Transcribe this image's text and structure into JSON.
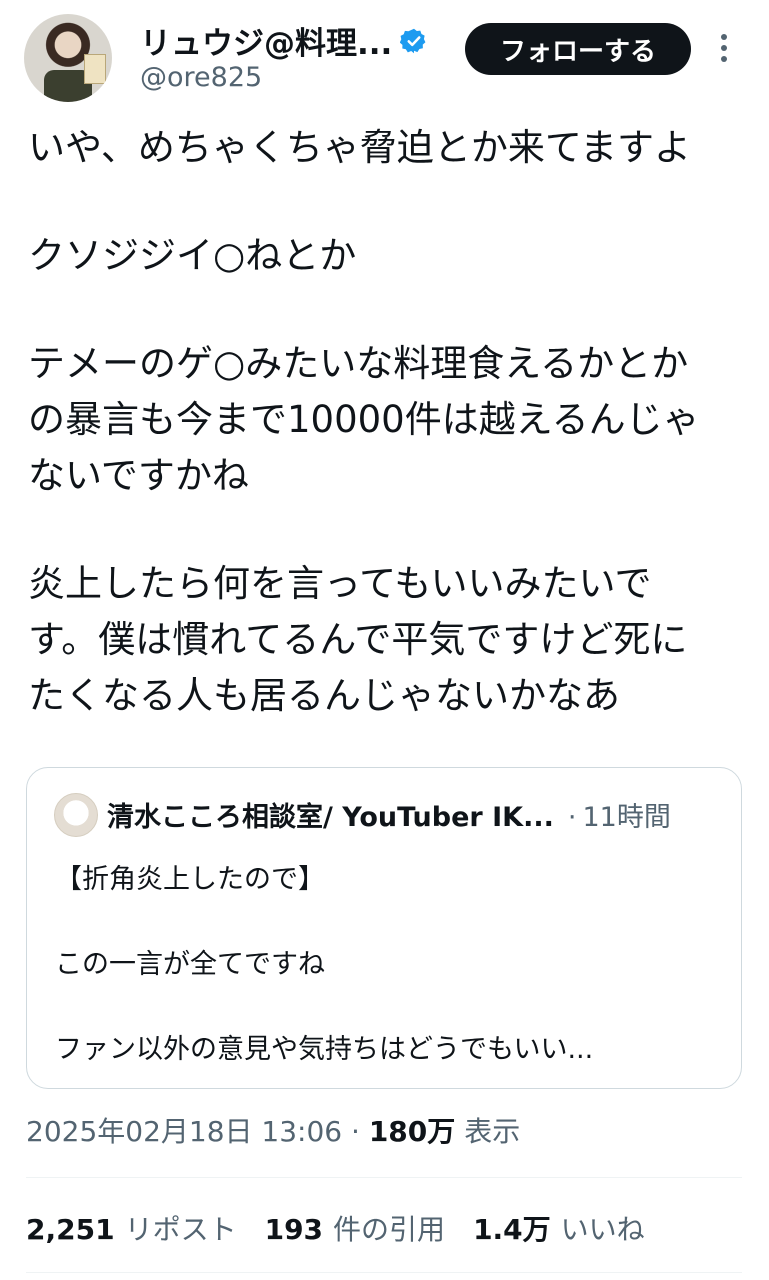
{
  "author": {
    "name": "リュウジ@料理...",
    "handle": "@ore825",
    "follow_label": "フォローする",
    "verified_color": "#1d9bf0"
  },
  "tweet": {
    "paragraphs": [
      "いや、めちゃくちゃ脅迫とか来てますよ",
      "クソジジイ○ねとか",
      "テメーのゲ○みたいな料理食えるかとか\nの暴言も今まで10000件は越えるんじゃ\nないですかね",
      "炎上したら何を言ってもいいみたいで\nす。僕は慣れてるんで平気ですけど死に\nたくなる人も居るんじゃないかなあ"
    ]
  },
  "quote": {
    "name": "清水こころ相談室/ YouTuber IK...",
    "time": "11時間",
    "lines": [
      "【折角炎上したので】",
      "この一言が全てですね",
      "ファン以外の意見や気持ちはどうでもいい..."
    ]
  },
  "meta": {
    "datetime": "2025年02月18日 13:06",
    "separator": "·",
    "views": "180万",
    "views_label": "表示"
  },
  "stats": [
    {
      "num": "2,251",
      "label": "リポスト"
    },
    {
      "num": "193",
      "label": "件の引用"
    },
    {
      "num": "1.4万",
      "label": "いいね"
    }
  ]
}
